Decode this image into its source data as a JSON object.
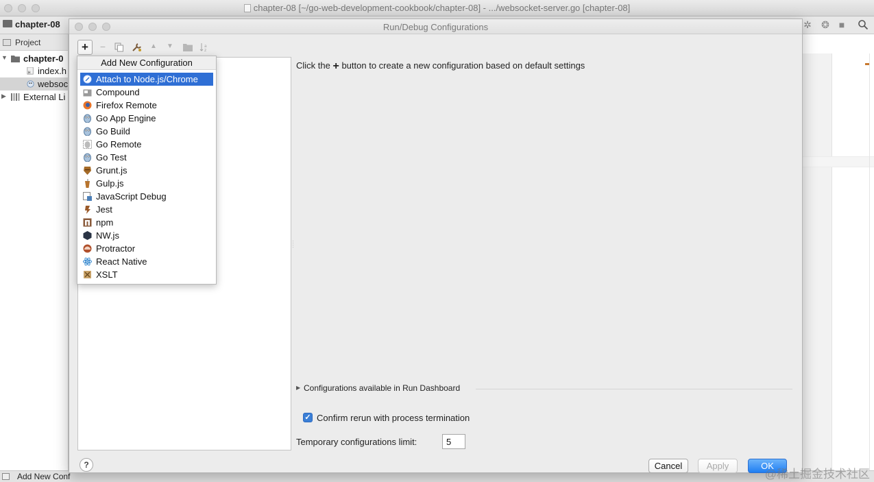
{
  "ide": {
    "window_title": "chapter-08 [~/go-web-development-cookbook/chapter-08] - .../websocket-server.go [chapter-08]",
    "nav_project": "chapter-08",
    "project_tool_label": "Project",
    "tree": [
      {
        "label": "chapter-0",
        "icon": "folder-icon"
      },
      {
        "label": "index.h",
        "icon": "html-file-icon"
      },
      {
        "label": "websoc",
        "icon": "go-file-icon"
      },
      {
        "label": "External Li",
        "icon": "library-icon"
      }
    ],
    "status_text": "Add New Conf",
    "watermark": "@稀土掘金技术社区"
  },
  "dialog": {
    "title": "Run/Debug Configurations",
    "toolbar": {
      "add": "+",
      "remove": "−",
      "copy": "copy-icon",
      "edit_defaults": "wrench-icon",
      "move_up": "▲",
      "move_down": "▼",
      "folder": "folder-icon",
      "sort": "sort-icon"
    },
    "hint_prefix": "Click the",
    "hint_plus": "+",
    "hint_suffix": "button to create a new configuration based on default settings",
    "run_dashboard_label": "Configurations available in Run Dashboard",
    "confirm_rerun_label": "Confirm rerun with process termination",
    "confirm_rerun_checked": true,
    "temp_limit_label": "Temporary configurations limit:",
    "temp_limit_value": "5",
    "help_label": "?",
    "buttons": {
      "cancel": "Cancel",
      "apply": "Apply",
      "ok": "OK"
    }
  },
  "popup": {
    "header": "Add New Configuration",
    "items": [
      {
        "label": "Attach to Node.js/Chrome",
        "icon": "node-attach-icon",
        "selected": true
      },
      {
        "label": "Compound",
        "icon": "compound-icon"
      },
      {
        "label": "Firefox Remote",
        "icon": "firefox-icon"
      },
      {
        "label": "Go App Engine",
        "icon": "gopher-icon"
      },
      {
        "label": "Go Build",
        "icon": "gopher-icon"
      },
      {
        "label": "Go Remote",
        "icon": "gopher-remote-icon"
      },
      {
        "label": "Go Test",
        "icon": "gopher-icon"
      },
      {
        "label": "Grunt.js",
        "icon": "grunt-icon"
      },
      {
        "label": "Gulp.js",
        "icon": "gulp-icon"
      },
      {
        "label": "JavaScript Debug",
        "icon": "js-debug-icon"
      },
      {
        "label": "Jest",
        "icon": "jest-icon"
      },
      {
        "label": "npm",
        "icon": "npm-icon"
      },
      {
        "label": "NW.js",
        "icon": "nwjs-icon"
      },
      {
        "label": "Protractor",
        "icon": "protractor-icon"
      },
      {
        "label": "React Native",
        "icon": "react-icon"
      },
      {
        "label": "XSLT",
        "icon": "xslt-icon"
      }
    ]
  },
  "colors": {
    "selection": "#2f6fd5",
    "primary_button": "#1f7ef2",
    "checkbox": "#3b7fd6"
  }
}
